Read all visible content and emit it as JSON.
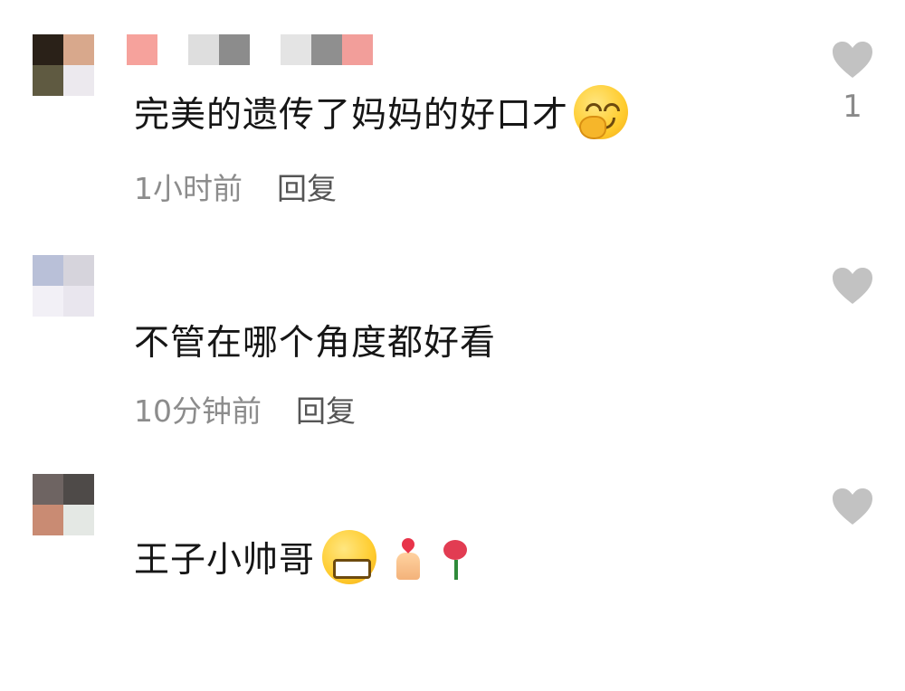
{
  "comments": [
    {
      "avatar_colors": [
        "#2a2118",
        "#d8a88c",
        "#5f5a41",
        "#ece9ee"
      ],
      "name_blocks": [
        "#f6a29c",
        "#f6f6f6",
        "#dedede",
        "#8c8c8c",
        "#e4e4e4",
        "#8f8f8f",
        "#f29e9a"
      ],
      "text": "完美的遗传了妈妈的好口才",
      "emoji": "hand-over-mouth-smile-emoji",
      "time": "1小时前",
      "reply": "回复",
      "likes": "1"
    },
    {
      "avatar_colors": [
        "#b9c0d8",
        "#d6d4dc",
        "#f2f0f6",
        "#e9e6ee"
      ],
      "text": "不管在哪个角度都好看",
      "time": "10分钟前",
      "reply": "回复",
      "likes": ""
    },
    {
      "avatar_colors": [
        "#6e6462",
        "#4e4a48",
        "#c98b73",
        "#e4e8e4"
      ],
      "text": "王子小帅哥",
      "emoji": "grinning-face-emoji",
      "extra_icons": [
        "finger-heart-icon",
        "rose-icon"
      ],
      "time": "",
      "reply": "",
      "likes": ""
    }
  ],
  "colors": {
    "like_heart": "#c2c2c2",
    "meta_text": "#8c8c8c"
  }
}
